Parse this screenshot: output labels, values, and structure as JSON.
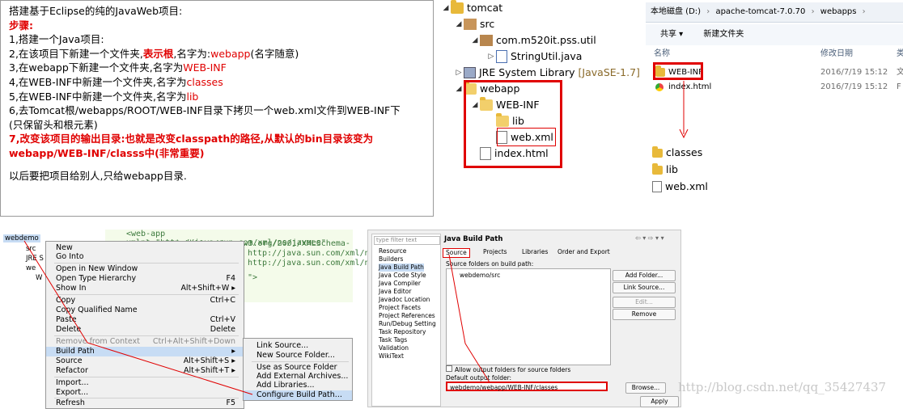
{
  "notes": {
    "title": "搭建基于Eclipse的纯的JavaWeb项目:",
    "steps_label": "步骤:",
    "s1": "1,搭建一个Java项目:",
    "s2_a": "2,在该项目下新建一个文件夹,",
    "s2_b": "表示根",
    "s2_c": ",名字为:",
    "s2_d": "webapp",
    "s2_e": "(名字随意)",
    "s3_a": "3,在webapp下新建一个文件夹,名字为",
    "s3_b": "WEB-INF",
    "s4_a": "4,在WEB-INF中新建一个文件夹,名字为",
    "s4_b": "classes",
    "s5_a": "5,在WEB-INF中新建一个文件夹,名字为",
    "s5_b": "lib",
    "s6_a": "6,去Tomcat根/webapps/ROOT/WEB-INF目录下拷贝一个web.xml文件到WEB-INF下",
    "s6_b": "(只保留头和根元素)",
    "s7_a": "7,改变该项目的输出目录:也就是改变classpath的路径,从默认的bin目录该变为",
    "s7_b": "webapp/WEB-INF/classs中(非常重要)",
    "footer": "以后要把项目给别人,只给webapp目录."
  },
  "tree": {
    "items": [
      "tomcat",
      "src",
      "com.m520it.pss.util",
      "StringUtil.java",
      "JRE System Library",
      "[JavaSE-1.7]",
      "webapp",
      "WEB-INF",
      "lib",
      "web.xml",
      "index.html"
    ]
  },
  "explorer": {
    "breadcrumb": [
      "本地磁盘 (D:)",
      "apache-tomcat-7.0.70",
      "webapps",
      "webapp"
    ],
    "share": "共享 ▾",
    "new_folder": "新建文件夹",
    "col_name": "名称",
    "col_date": "修改日期",
    "col_type": "类",
    "rows": [
      {
        "name": "WEB-INF",
        "date": "2016/7/19 15:12",
        "type": "文"
      },
      {
        "name": "index.html",
        "date": "2016/7/19 15:12",
        "type": "F"
      }
    ],
    "sub_items": [
      "classes",
      "lib",
      "web.xml"
    ]
  },
  "ctxmenu": {
    "tree_items": [
      "webdemo",
      "src",
      "JRE S",
      "we",
      "W"
    ],
    "code1": "<web-app xmlns=\"http://java.sun.com/xml/ns/javaee\"",
    "code2": "xmlns:xsi=\"http://www.w3.org/2001/XMLSchema-in",
    "code3": "http://java.sun.com/xml/ns",
    "code4": "http://java.sun.com/xml/ns",
    "code5": "\">",
    "items": [
      {
        "label": "New",
        "sc": ""
      },
      {
        "label": "Go Into",
        "sc": ""
      },
      {
        "label": "Open in New Window",
        "sc": ""
      },
      {
        "label": "Open Type Hierarchy",
        "sc": "F4"
      },
      {
        "label": "Show In",
        "sc": "Alt+Shift+W ▸"
      },
      {
        "label": "Copy",
        "sc": "Ctrl+C"
      },
      {
        "label": "Copy Qualified Name",
        "sc": ""
      },
      {
        "label": "Paste",
        "sc": "Ctrl+V"
      },
      {
        "label": "Delete",
        "sc": "Delete"
      },
      {
        "label": "Remove from Context",
        "sc": "Ctrl+Alt+Shift+Down"
      },
      {
        "label": "Build Path",
        "sc": "▸"
      },
      {
        "label": "Source",
        "sc": "Alt+Shift+S ▸"
      },
      {
        "label": "Refactor",
        "sc": "Alt+Shift+T ▸"
      },
      {
        "label": "Import...",
        "sc": ""
      },
      {
        "label": "Export...",
        "sc": ""
      },
      {
        "label": "Refresh",
        "sc": "F5"
      }
    ],
    "sub": [
      "Link Source...",
      "New Source Folder...",
      "Use as Source Folder",
      "Add External Archives...",
      "Add Libraries...",
      "Configure Build Path..."
    ]
  },
  "jbp": {
    "filter": "type filter text",
    "side": [
      "Resource",
      "Builders",
      "Java Build Path",
      "Java Code Style",
      "Java Compiler",
      "Java Editor",
      "Javadoc Location",
      "Project Facets",
      "Project References",
      "Run/Debug Setting",
      "Task Repository",
      "Task Tags",
      "Validation",
      "WikiText"
    ],
    "title": "Java Build Path",
    "tabs": [
      "Source",
      "Projects",
      "Libraries",
      "Order and Export"
    ],
    "folders_label": "Source folders on build path:",
    "folder": "webdemo/src",
    "buttons": [
      "Add Folder...",
      "Link Source...",
      "Edit...",
      "Remove"
    ],
    "allow": "Allow output folders for source folders",
    "output_label": "Default output folder:",
    "output_value": "webdemo/webapp/WEB-INF/classes",
    "browse": "Browse...",
    "apply": "Apply"
  },
  "watermark": "http://blog.csdn.net/qq_35427437"
}
